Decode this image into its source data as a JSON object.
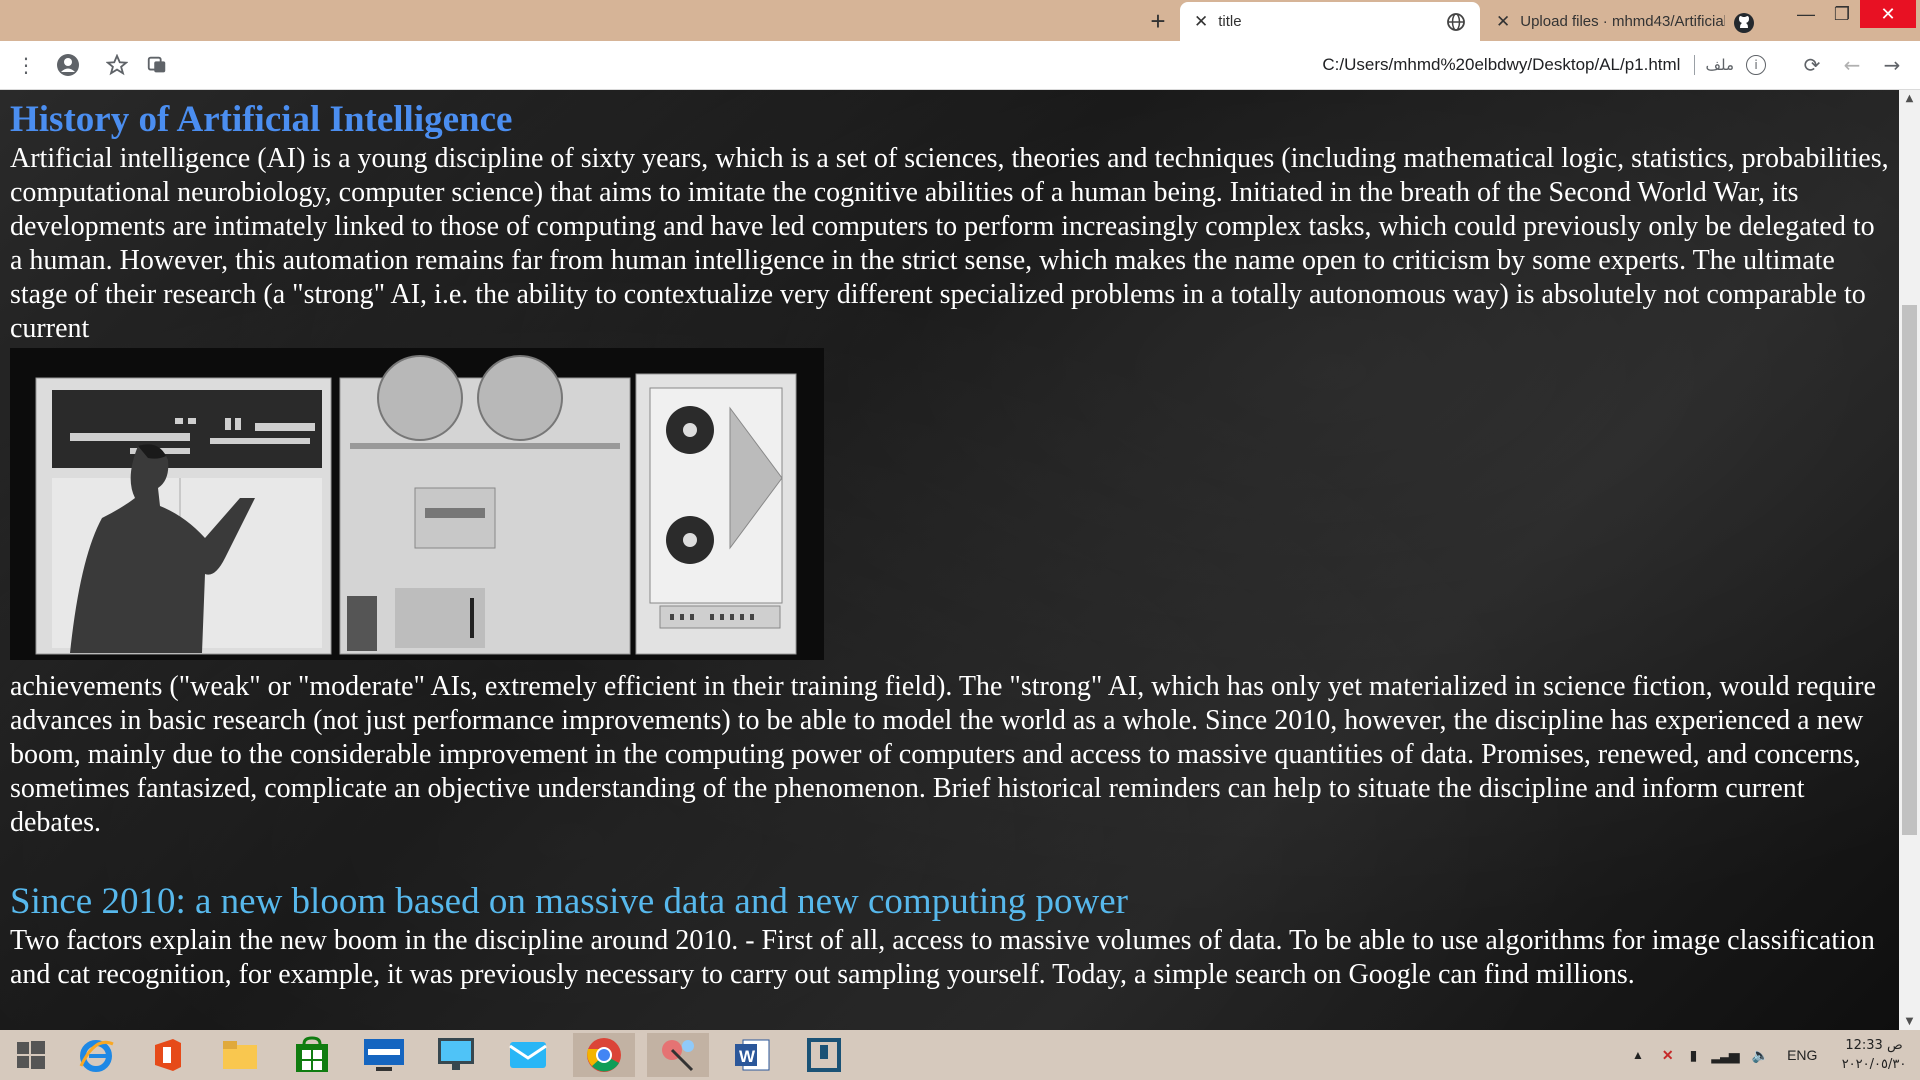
{
  "browser": {
    "new_tab_symbol": "+",
    "tabs": [
      {
        "title": "title",
        "close_symbol": "✕",
        "icon": "globe-icon",
        "active": true
      },
      {
        "title": "Upload files · mhmd43/Artificial-",
        "close_symbol": "✕",
        "icon": "github-icon",
        "active": false
      }
    ],
    "window_controls": {
      "minimize": "—",
      "maximize": "❐",
      "close": "✕"
    },
    "toolbar": {
      "menu_icon": "⋮",
      "url": "C:/Users/mhmd%20elbdwy/Desktop/AL/p1.html",
      "scheme_label": "ملف",
      "info_symbol": "i",
      "reload_symbol": "⟳",
      "back_symbol": "←",
      "forward_symbol": "→"
    }
  },
  "page": {
    "title": "History of Artificial Intelligence",
    "paragraph1": "Artificial intelligence (AI) is a young discipline of sixty years, which is a set of sciences, theories and techniques (including mathematical logic, statistics, probabilities, computational neurobiology, computer science) that aims to imitate the cognitive abilities of a human being. Initiated in the breath of the Second World War, its developments are intimately linked to those of computing and have led computers to perform increasingly complex tasks, which could previously only be delegated to a human. However, this automation remains far from human intelligence in the strict sense, which makes the name open to criticism by some experts. The ultimate stage of their research (a \"strong\" AI, i.e. the ability to contextualize very different specialized problems in a totally autonomous way) is absolutely not comparable to current",
    "image_description": "vintage-computer-photo",
    "paragraph2": "achievements (\"weak\" or \"moderate\" AIs, extremely efficient in their training field). The \"strong\" AI, which has only yet materialized in science fiction, would require advances in basic research (not just performance improvements) to be able to model the world as a whole. Since 2010, however, the discipline has experienced a new boom, mainly due to the considerable improvement in the computing power of computers and access to massive quantities of data. Promises, renewed, and concerns, sometimes fantasized, complicate an objective understanding of the phenomenon. Brief historical reminders can help to situate the discipline and inform current debates.",
    "section_title": "Since 2010: a new bloom based on massive data and new computing power",
    "paragraph3": "Two factors explain the new boom in the discipline around 2010. - First of all, access to massive volumes of data. To be able to use algorithms for image classification and cat recognition, for example, it was previously necessary to carry out sampling yourself. Today, a simple search on Google can find millions."
  },
  "taskbar": {
    "apps": [
      "windows-start-icon",
      "internet-explorer-icon",
      "office-icon",
      "file-explorer-icon",
      "store-icon",
      "lenovo-icon",
      "monitor-icon",
      "mail-icon",
      "home-icon",
      "chrome-icon",
      "snipping-icon",
      "word-icon",
      "app-icon"
    ],
    "language": "ENG",
    "time": "12:33 ص",
    "date": "٢٠٢٠/٠٥/٣٠"
  }
}
